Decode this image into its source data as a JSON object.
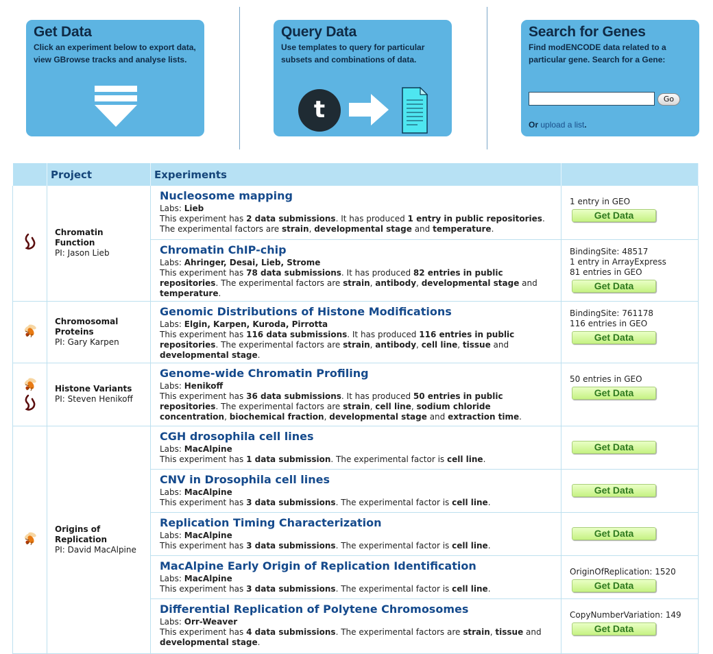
{
  "panels": {
    "get_data": {
      "title": "Get Data",
      "desc_line1": "Click an experiment below to export data,",
      "desc_line2": "view GBrowse tracks and analyse lists."
    },
    "query_data": {
      "title": "Query Data",
      "desc_line1": "Use templates to query for particular",
      "desc_line2": "subsets and combinations of data.",
      "template_letter": "t"
    },
    "search_genes": {
      "title": "Search for Genes",
      "desc_line1": "Find modENCODE data related to a",
      "desc_line2": "particular gene. Search for a Gene:",
      "input_value": "",
      "go_label": "Go",
      "upload_prefix": "Or ",
      "upload_link": "upload a list",
      "upload_suffix": "."
    }
  },
  "table": {
    "headers": [
      "",
      "Project",
      "Experiments",
      ""
    ],
    "get_data_label": "Get Data",
    "labs_prefix": "Labs: ",
    "rows": [
      {
        "project": "Chromatin Function",
        "pi": "PI: Jason Lieb",
        "icon": "worm-icon",
        "experiments": [
          {
            "title": "Nucleosome mapping",
            "labs": "Lieb",
            "desc_parts": [
              "This experiment has ",
              "2 data submissions",
              ". It has produced ",
              "1 entry in public repositories",
              ". The experimental factors are ",
              "strain",
              ", ",
              "developmental stage",
              " and ",
              "temperature",
              "."
            ],
            "results": [
              "1 entry in GEO"
            ]
          },
          {
            "title": "Chromatin ChIP-chip",
            "labs": "Ahringer, Desai, Lieb, Strome",
            "desc_parts": [
              "This experiment has ",
              "78 data submissions",
              ". It has produced ",
              "82 entries in public repositories",
              ". The experimental factors are ",
              "strain",
              ", ",
              "antibody",
              ", ",
              "developmental stage",
              " and ",
              "temperature",
              "."
            ],
            "results": [
              "BindingSite: 48517",
              "1 entry in ArrayExpress",
              "81 entries in GEO"
            ]
          }
        ]
      },
      {
        "project": "Chromosomal Proteins",
        "pi": "PI: Gary Karpen",
        "icon": "fly-icon",
        "experiments": [
          {
            "title": "Genomic Distributions of Histone Modifications",
            "labs": "Elgin, Karpen, Kuroda, Pirrotta",
            "desc_parts": [
              "This experiment has ",
              "116 data submissions",
              ". It has produced ",
              "116 entries in public repositories",
              ". The experimental factors are ",
              "strain",
              ", ",
              "antibody",
              ", ",
              "cell line",
              ", ",
              "tissue",
              " and ",
              "developmental stage",
              "."
            ],
            "results": [
              "BindingSite: 761178",
              "116 entries in GEO"
            ]
          }
        ]
      },
      {
        "project": "Histone Variants",
        "pi": "PI: Steven Henikoff",
        "icon": "fly-worm-icon",
        "experiments": [
          {
            "title": "Genome-wide Chromatin Profiling",
            "labs": "Henikoff",
            "desc_parts": [
              "This experiment has ",
              "36 data submissions",
              ". It has produced ",
              "50 entries in public repositories",
              ". The experimental factors are ",
              "strain",
              ", ",
              "cell line",
              ", ",
              "sodium chloride concentration",
              ", ",
              "biochemical fraction",
              ", ",
              "developmental stage",
              " and ",
              "extraction time",
              "."
            ],
            "results": [
              "50 entries in GEO"
            ]
          }
        ]
      },
      {
        "project": "Origins of Replication",
        "pi": "PI: David MacAlpine",
        "icon": "fly-icon",
        "experiments": [
          {
            "title": "CGH drosophila cell lines",
            "labs": "MacAlpine",
            "desc_parts": [
              "This experiment has ",
              "1 data submission",
              ". The experimental factor is ",
              "cell line",
              "."
            ],
            "results": []
          },
          {
            "title": "CNV in Drosophila cell lines",
            "labs": "MacAlpine",
            "desc_parts": [
              "This experiment has ",
              "3 data submissions",
              ". The experimental factor is ",
              "cell line",
              "."
            ],
            "results": []
          },
          {
            "title": "Replication Timing Characterization",
            "labs": "MacAlpine",
            "desc_parts": [
              "This experiment has ",
              "3 data submissions",
              ". The experimental factor is ",
              "cell line",
              "."
            ],
            "results": []
          },
          {
            "title": "MacAlpine Early Origin of Replication Identification",
            "labs": "MacAlpine",
            "desc_parts": [
              "This experiment has ",
              "3 data submissions",
              ". The experimental factor is ",
              "cell line",
              "."
            ],
            "results": [
              "OriginOfReplication: 1520"
            ]
          },
          {
            "title": "Differential Replication of Polytene Chromosomes",
            "labs": "Orr-Weaver",
            "desc_parts": [
              "This experiment has ",
              "4 data submissions",
              ". The experimental factors are ",
              "strain",
              ", ",
              "tissue",
              " and ",
              "developmental stage",
              "."
            ],
            "results": [
              "CopyNumberVariation: 149"
            ]
          }
        ]
      }
    ]
  },
  "colors": {
    "panel_bg": "#5db4e2",
    "header_bg": "#b7e1f4",
    "title_link": "#154a8c",
    "button_green": "#c6f283"
  }
}
